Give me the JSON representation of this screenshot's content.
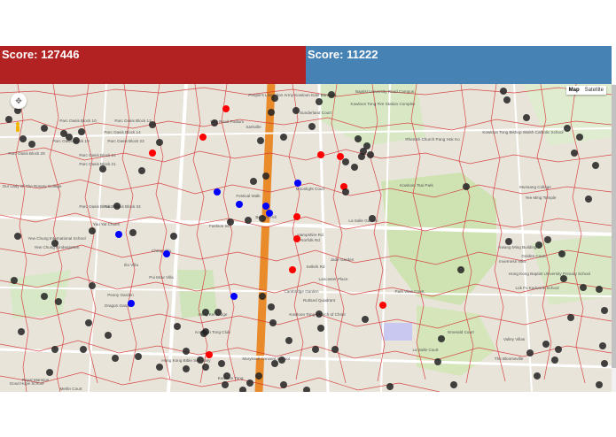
{
  "scores": {
    "left": {
      "label": "Score: 127446",
      "color": "#b22222"
    },
    "right": {
      "label": "Score: 11222",
      "color": "#4682b4"
    }
  },
  "map": {
    "type_control": {
      "map": "Map",
      "satellite": "Satellite"
    },
    "colors": {
      "voronoi": "#d32f2f",
      "red_team": "#ff0000",
      "blue_team": "#0000ff",
      "neutral": "#222222",
      "road": "#e98a2b"
    },
    "places": [
      {
        "name": "Our Lady Of The Rosary College"
      },
      {
        "name": "Parc Oasis Block 10"
      },
      {
        "name": "Parc Oasis Block 12"
      },
      {
        "name": "Parc Oasis Block 14"
      },
      {
        "name": "Parc Oasis Block 23"
      },
      {
        "name": "Parc Oasis Block 19"
      },
      {
        "name": "Parc Oasis Block 24"
      },
      {
        "name": "Parc Oasis Block 29"
      },
      {
        "name": "Parc Oasis Block 21"
      },
      {
        "name": "Parc Oasis Block 33"
      },
      {
        "name": "Parc Oasis Block 34"
      },
      {
        "name": "Yew Chung International School"
      },
      {
        "name": "Yew Chung Kindergarten"
      },
      {
        "name": "Beacon Hill"
      },
      {
        "name": "Yau Yat Chuen"
      },
      {
        "name": "Ching Villa"
      },
      {
        "name": "Ilio Villa"
      },
      {
        "name": "Peony Garden"
      },
      {
        "name": "Pui Mow Villa"
      },
      {
        "name": "Dragon Garden"
      },
      {
        "name": "Kowloon Tong Club"
      },
      {
        "name": "Hong Kong Bible Seminary"
      },
      {
        "name": "Kowloon Tong"
      },
      {
        "name": "Festival Walk"
      },
      {
        "name": "Fashion Inn"
      },
      {
        "name": "Sarkville"
      },
      {
        "name": "York Road Podium"
      },
      {
        "name": "Sunderland Court"
      },
      {
        "name": "Cambridge Garden"
      },
      {
        "name": "Kowloon Tong Church of Christ"
      },
      {
        "name": "La Salle Garden"
      },
      {
        "name": "Lancaster Place"
      },
      {
        "name": "Jade Garden"
      },
      {
        "name": "Maryknoll Convent School"
      },
      {
        "name": "La Salle Court"
      },
      {
        "name": "Park View Court"
      },
      {
        "name": "Emerald Court"
      },
      {
        "name": "Valley Villas"
      },
      {
        "name": "The Bloomsville"
      },
      {
        "name": "Kowloon Tsai Park"
      },
      {
        "name": "Rhenish Church Pang Hok Ko"
      },
      {
        "name": "Kowloon Tong Bishop Walsh Catholic School"
      },
      {
        "name": "Munsang College"
      },
      {
        "name": "Yee Ming Temple"
      },
      {
        "name": "Kwang Ming Building"
      },
      {
        "name": "Inverness Villa"
      },
      {
        "name": "Golden Court"
      },
      {
        "name": "Baptist University Road Campus"
      },
      {
        "name": "Kowloon Tong Fire Station Complex"
      },
      {
        "name": "People's Liberation Army Kowloon East Barracks"
      },
      {
        "name": "Lok Fu Kadoorie School"
      },
      {
        "name": "Hong Kong Baptist University Primary School"
      },
      {
        "name": "Hang Kei Lodge"
      },
      {
        "name": "Good Hope School"
      },
      {
        "name": "Moonlight Court"
      },
      {
        "name": "Hampshire Rd"
      },
      {
        "name": "Norfolk Rd"
      },
      {
        "name": "Selkirk Rd"
      },
      {
        "name": "Rutland Quadrant"
      },
      {
        "name": "Merlin Court"
      },
      {
        "name": "Royal Mansion"
      }
    ]
  }
}
